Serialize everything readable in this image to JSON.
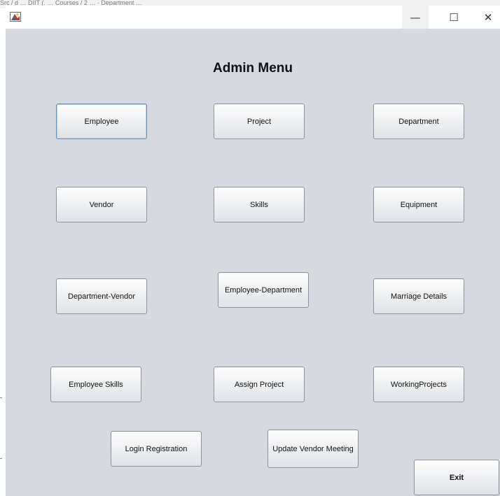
{
  "background_text": "Src / d  … DIIT (.  … Courses / 2 … · Department …",
  "window": {
    "title": "",
    "controls": {
      "minimize": "—",
      "maximize": "☐",
      "close": "✕"
    }
  },
  "heading": "Admin Menu",
  "buttons": {
    "employee": "Employee",
    "project": "Project",
    "department": "Department",
    "vendor": "Vendor",
    "skills": "Skills",
    "equipment": "Equipment",
    "department_vendor": "Department-Vendor",
    "employee_department": "Employee-Department",
    "marriage_details": "Marriage Details",
    "employee_skills": "Employee Skills",
    "assign_project": "Assign Project",
    "working_projects": "WorkingProjects",
    "login_registration": "Login Registration",
    "update_vendor_meeting": "Update Vendor Meeting",
    "exit": "Exit"
  },
  "focused_button": "Employee",
  "colors": {
    "panel_background": "#d6d9df",
    "button_border": "#8e939b",
    "focus_border": "#6e8fb3"
  }
}
